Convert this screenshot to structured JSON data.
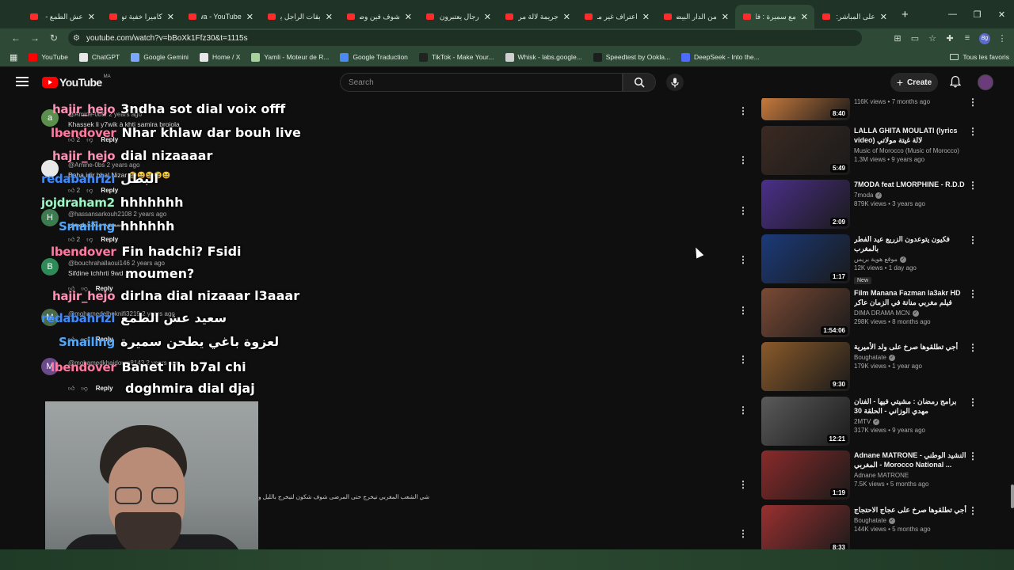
{
  "browser": {
    "tabs": [
      {
        "title": "عش الطمع - ..."
      },
      {
        "title": "كاميرا خفية تونسية"
      },
      {
        "title": "marwa - YouTube"
      },
      {
        "title": "بقات الراجل يكوي"
      },
      {
        "title": "شوف فين وصلو"
      },
      {
        "title": "رجال يعتبرون الـ"
      },
      {
        "title": "جريمة لالة مريم"
      },
      {
        "title": "اعتراف غير مسبوق"
      },
      {
        "title": "من الدار البيضاء"
      },
      {
        "title": "مع سميرة : فاش"
      },
      {
        "title": "على المباشر: الـ"
      }
    ],
    "tab_close": "✕",
    "new_tab": "+",
    "url": "youtube.com/watch?v=bBoXk1Ffz30&t=1115s",
    "bookmarks": [
      {
        "label": "YouTube",
        "color": "#ff0000"
      },
      {
        "label": "ChatGPT",
        "color": "#e8e8e8"
      },
      {
        "label": "Google Gemini",
        "color": "#7aa7ff"
      },
      {
        "label": "Home / X",
        "color": "#e8e8e8"
      },
      {
        "label": "Yamli - Moteur de R...",
        "color": "#a7d29a"
      },
      {
        "label": "Google Traduction",
        "color": "#4a8af4"
      },
      {
        "label": "TikTok - Make Your...",
        "color": "#222222"
      },
      {
        "label": "Whisk - labs.google...",
        "color": "#cfcfcf"
      },
      {
        "label": "Speedtest by Ookla...",
        "color": "#1d1d1d"
      },
      {
        "label": "DeepSeek - Into the...",
        "color": "#4d6bfe"
      }
    ],
    "all_bookmarks": "Tous les favoris",
    "profile_initials": "Bg"
  },
  "youtube": {
    "logo_text": "YouTube",
    "country_code": "MA",
    "search_placeholder": "Search",
    "create_label": "Create"
  },
  "comments": [
    {
      "initial": "a",
      "avatar_color": "#5b8f4e",
      "author": "@Amine-0bsr 2 years ago",
      "text": "Khassek li y7wik à khti samira broiola",
      "likes": "2",
      "reply": "Reply"
    },
    {
      "initial": "",
      "avatar_color": "#e8e8e8",
      "author": "@Amine-0bs 2 years ago",
      "text": "Baha idir bhal Nizar 😆😆😆😆😆",
      "likes": "2",
      "reply": "Reply"
    },
    {
      "initial": "H",
      "avatar_color": "#3c7a4f",
      "author": "@hassansarkouh2108 2 years ago",
      "text": "سميرة ماكتحشمش",
      "likes": "2",
      "reply": "Reply"
    },
    {
      "initial": "B",
      "avatar_color": "#2e8b57",
      "author": "@bouchrahallaoui146 2 years ago",
      "text": "Sifdine tchhrti 9wd ...",
      "likes": "",
      "reply": "Reply"
    },
    {
      "initial": "M",
      "avatar_color": "#4a6a4a",
      "author": "@mohamedelboknifi3219 2 years ago",
      "text": "",
      "likes": "",
      "reply": "Reply"
    },
    {
      "initial": "M",
      "avatar_color": "#6b4a8a",
      "author": "@mohamedkhaidoum8143 2 years ago",
      "text": "",
      "likes": "",
      "reply": "Reply"
    }
  ],
  "long_comment": "شي الشعب المغربي تيخرج حتى المرضى شوف شكون لتيخرج بالليل و",
  "chat": [
    {
      "name": "hajir_hejo",
      "color": "#ff8fb5",
      "msg": "3ndha sot dial voix offf"
    },
    {
      "name": "lbendover",
      "color": "#ff7aa2",
      "msg": "Nhar khlaw dar bouh live"
    },
    {
      "name": "hajir_hejo",
      "color": "#ff8fb5",
      "msg": "dial nizaaaar"
    },
    {
      "name": "redabahrizi",
      "color": "#3d8bff",
      "msg": "البطل"
    },
    {
      "name": "jojdraham2",
      "color": "#9cf7c4",
      "msg": "hhhhhhh"
    },
    {
      "name": "Smailing",
      "color": "#4fa8ff",
      "msg": "hhhhhh"
    },
    {
      "name": "lbendover",
      "color": "#ff7aa2",
      "msg": "Fin hadchi? Fsidi"
    },
    {
      "name": "",
      "color": "#ffffff",
      "msg": "moumen?"
    },
    {
      "name": "hajir_hejo",
      "color": "#ff8fb5",
      "msg": "dirlna dial nizaaar l3aaar"
    },
    {
      "name": "redabahrizi",
      "color": "#3d8bff",
      "msg": "سعيد عش الطمع"
    },
    {
      "name": "Smailing",
      "color": "#4fa8ff",
      "msg": "لعزوة باغي يطحن سميرة"
    },
    {
      "name": "lbendover",
      "color": "#ff7aa2",
      "msg": "Banet lih b7al chi"
    },
    {
      "name": "",
      "color": "#ffffff",
      "msg": "doghmira dial djaj"
    }
  ],
  "sidebar": [
    {
      "title": "",
      "channel": "",
      "meta": "116K views • 7 months ago",
      "duration": "8:40",
      "thumb": "#c97b3d",
      "verified": false,
      "badge": ""
    },
    {
      "title": "LALLA GHITA MOULATI (lyrics video) لالة غيتة مولاتي",
      "channel": "Music of Morocco (Music of Morocco)",
      "meta": "1.3M views • 9 years ago",
      "duration": "5:49",
      "thumb": "#3b2a22",
      "verified": false,
      "badge": ""
    },
    {
      "title": "7MODA feat LMORPHINE - R.D.D",
      "channel": "7moda",
      "meta": "879K views • 3 years ago",
      "duration": "2:09",
      "thumb": "#4b2f8a",
      "verified": true,
      "badge": ""
    },
    {
      "title": "فكيون يتوعدون الزريع عيد الفطر بالمغرب",
      "channel": "موقع هوية بريس",
      "meta": "12K views • 1 day ago",
      "duration": "1:17",
      "thumb": "#1b3a7a",
      "verified": true,
      "badge": "New"
    },
    {
      "title": "Film Manana Fazman la3akr HD فيلم مغربي منانة في الزمان عاكر",
      "channel": "DIMA DRAMA MCN",
      "meta": "298K views • 8 months ago",
      "duration": "1:54:06",
      "thumb": "#7a4a35",
      "verified": true,
      "badge": ""
    },
    {
      "title": "أجي تطلقوها صرخ على ولد الأميرية",
      "channel": "Boughatate",
      "meta": "179K views • 1 year ago",
      "duration": "9:30",
      "thumb": "#8a5a2a",
      "verified": true,
      "badge": ""
    },
    {
      "title": "برامج رمضان : مشيتي فيها - الفنان مهدي الوزاني - الحلقة 30",
      "channel": "2MTV",
      "meta": "317K views • 9 years ago",
      "duration": "12:21",
      "thumb": "#5a5a5a",
      "verified": true,
      "badge": ""
    },
    {
      "title": "Adnane MATRONE - النشيد الوطني المغربي - Morocco National ...",
      "channel": "Adnane MATRONE",
      "meta": "7.5K views • 5 months ago",
      "duration": "1:19",
      "thumb": "#8a2a2a",
      "verified": false,
      "badge": ""
    },
    {
      "title": "أجي تطلقوها صرخ على عجاج الاحتجاج",
      "channel": "Boughatate",
      "meta": "144K views • 5 months ago",
      "duration": "8:33",
      "thumb": "#9a3030",
      "verified": true,
      "badge": ""
    }
  ]
}
